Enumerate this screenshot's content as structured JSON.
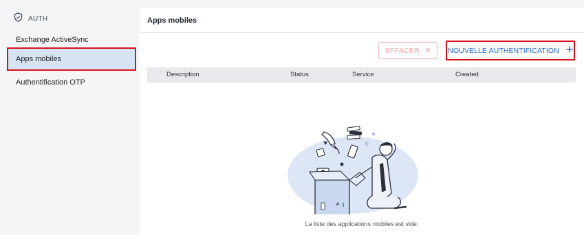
{
  "sidebar": {
    "section": "AUTH",
    "items": [
      {
        "label": "Exchange ActiveSync"
      },
      {
        "label": "Apps mobiles"
      },
      {
        "label": "Authentification OTP"
      }
    ]
  },
  "main": {
    "title": "Apps mobiles",
    "toolbar": {
      "clear_label": "EFFACER",
      "new_label": "NOUVELLE AUTHENTIFICATION"
    },
    "table": {
      "columns": [
        "Description",
        "Status",
        "Service",
        "Created"
      ]
    },
    "empty_message": "La liste des applications mobiles est vide."
  },
  "colors": {
    "accent": "#2266d0",
    "highlight_outline": "#d9101c",
    "active_item_bg": "#d6e3f2",
    "clear_button": "#f0a6a6"
  },
  "icons": {
    "section": "shield-icon",
    "clear": "close-icon",
    "new": "plus-icon",
    "empty_state": "empty-box-illustration"
  }
}
